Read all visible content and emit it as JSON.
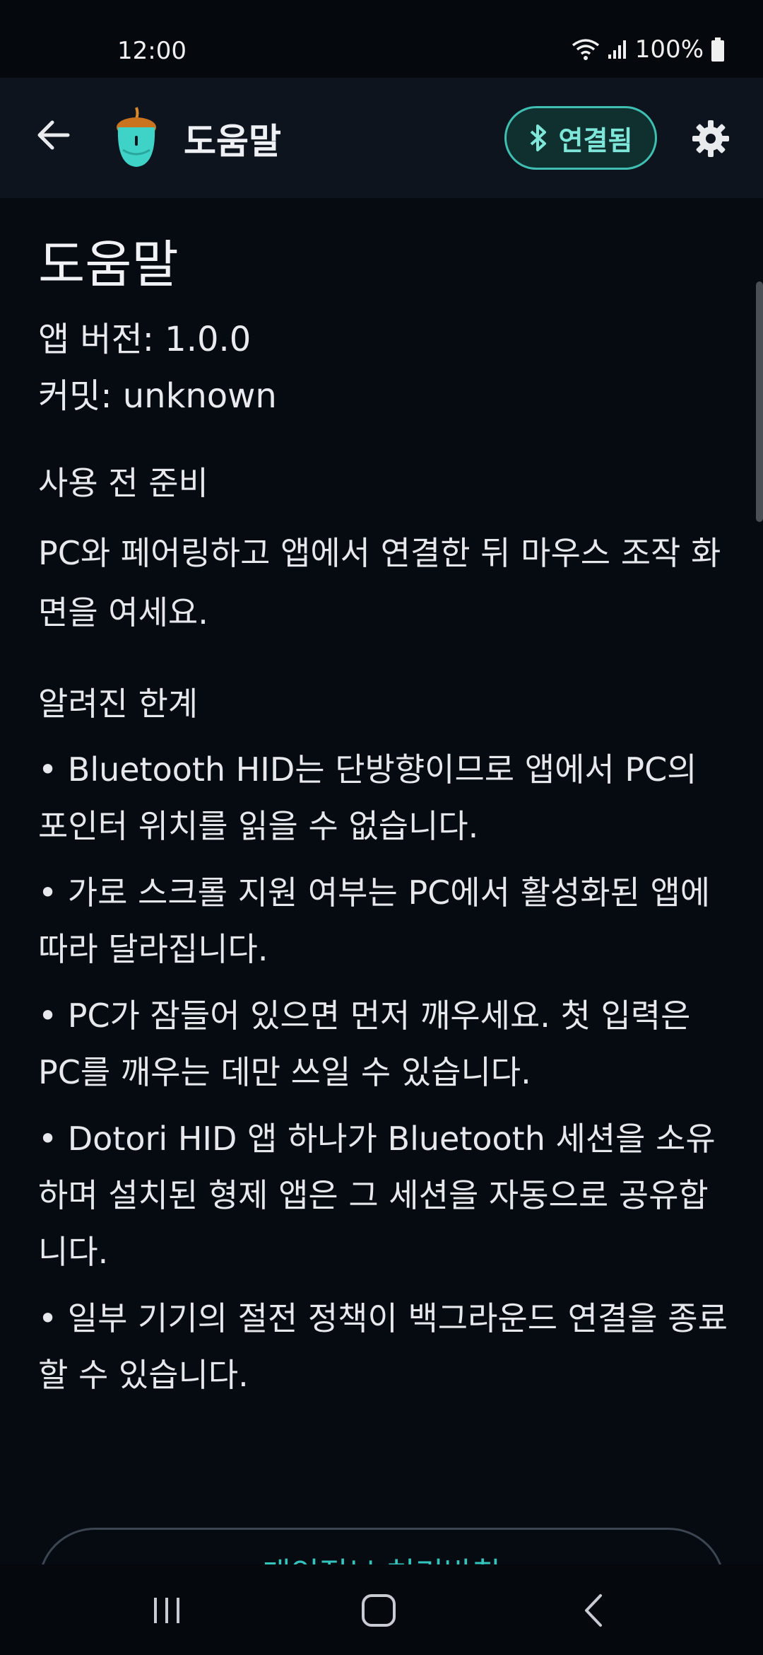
{
  "status_bar": {
    "time": "12:00",
    "battery_percent": "100%",
    "icons": [
      "wifi-icon",
      "cellular-signal-icon",
      "battery-icon"
    ]
  },
  "app_bar": {
    "title": "도움말",
    "connection_chip": "연결됨",
    "icons": [
      "back-arrow-icon",
      "app-logo-icon",
      "bluetooth-icon",
      "gear-icon"
    ],
    "accent_color": "#3fbfb1"
  },
  "content": {
    "heading": "도움말",
    "app_version": "앱 버전: 1.0.0",
    "commit": "커밋: unknown",
    "prep_title": "사용 전 준비",
    "prep_text": "PC와 페어링하고 앱에서 연결한 뒤 마우스 조작 화면을 여세요.",
    "limits_title": "알려진 한계",
    "limits": [
      "• Bluetooth HID는 단방향이므로 앱에서 PC의 포인터 위치를 읽을 수 없습니다.",
      "• 가로 스크롤 지원 여부는 PC에서 활성화된 앱에 따라 달라집니다.",
      "• PC가 잠들어 있으면 먼저 깨우세요. 첫 입력은 PC를 깨우는 데만 쓰일 수 있습니다.",
      "• Dotori HID 앱 하나가 Bluetooth 세션을 소유하며 설치된 형제 앱은 그 세션을 자동으로 공유합니다.",
      "• 일부 기기의 절전 정책이 백그라운드 연결을 종료할 수 있습니다."
    ],
    "privacy_button": "개인정보 처리방침"
  },
  "nav_bar": {
    "icons": [
      "recent-apps-icon",
      "home-icon",
      "back-icon"
    ]
  }
}
